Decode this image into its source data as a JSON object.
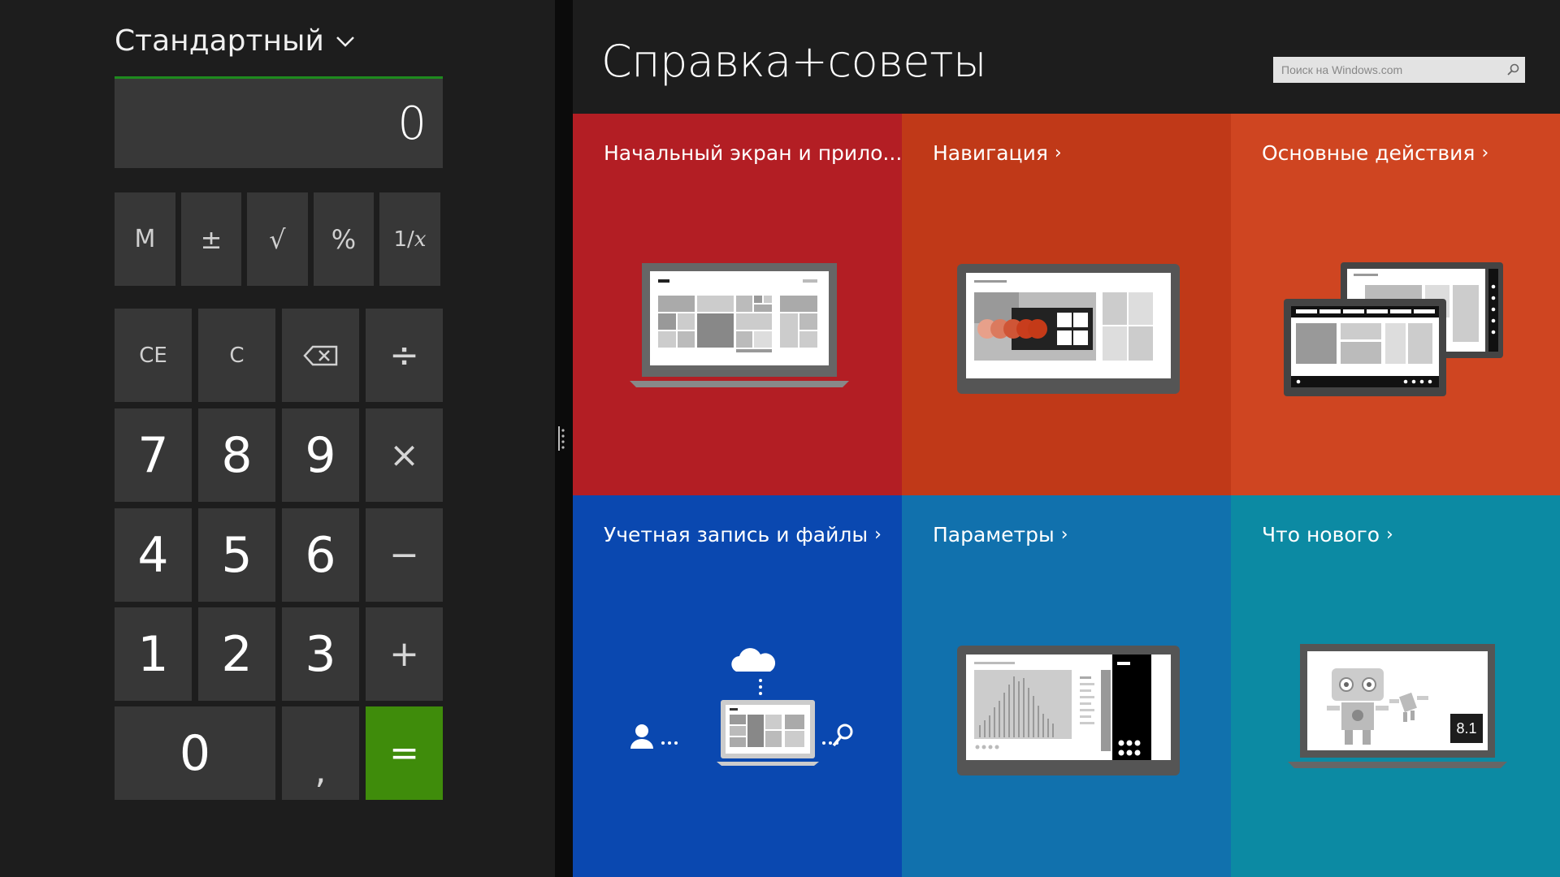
{
  "calculator": {
    "mode_label": "Стандартный",
    "display_value": "0",
    "memory_row": [
      "M",
      "±",
      "√",
      "%",
      "1/x"
    ],
    "recip_num": "1/",
    "recip_var": "x",
    "keys": {
      "ce": "CE",
      "c": "C",
      "divide": "÷",
      "seven": "7",
      "eight": "8",
      "nine": "9",
      "multiply": "×",
      "four": "4",
      "five": "5",
      "six": "6",
      "minus": "−",
      "one": "1",
      "two": "2",
      "three": "3",
      "plus": "+",
      "zero": "0",
      "decimal": ",",
      "equals": "="
    },
    "colors": {
      "accent": "#1e8a1e",
      "equals_bg": "#3f8c0b",
      "key_bg": "#373737"
    }
  },
  "help": {
    "title": "Справка+советы",
    "search": {
      "placeholder": "Поиск на Windows.com"
    },
    "tiles": [
      {
        "label": "Начальный экран и прило...",
        "color": "#b31e24"
      },
      {
        "label": "Навигация",
        "color": "#c03918"
      },
      {
        "label": "Основные действия",
        "color": "#cf4521"
      },
      {
        "label": "Учетная запись и файлы",
        "color": "#0a48b0"
      },
      {
        "label": "Параметры",
        "color": "#1171ad"
      },
      {
        "label": "Что нового",
        "color": "#0c8aa3"
      }
    ],
    "whats_new_badge": "8.1"
  }
}
